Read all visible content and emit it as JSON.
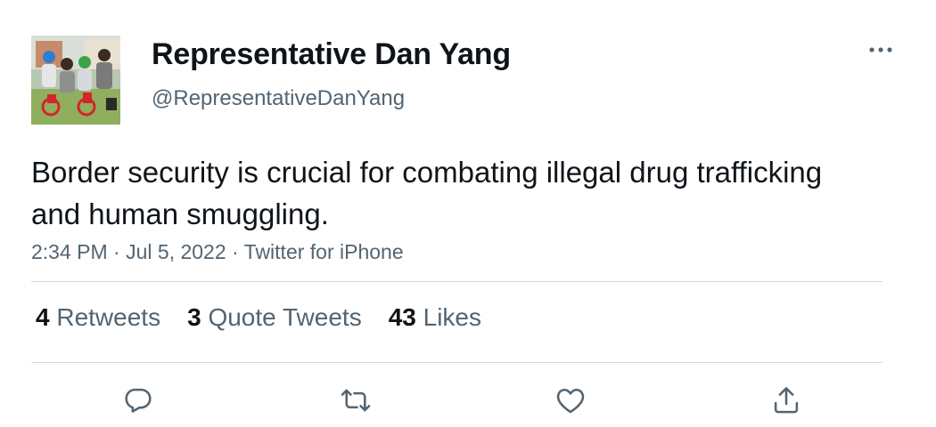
{
  "author": {
    "display_name": "Representative Dan Yang",
    "handle": "@RepresentativeDanYang"
  },
  "tweet": {
    "text": "Border security is crucial for combating illegal drug trafficking and human smuggling.",
    "time": "2:34 PM",
    "date": "Jul 5, 2022",
    "source": "Twitter for iPhone",
    "separator": " · "
  },
  "stats": {
    "retweets_count": "4",
    "retweets_label": "Retweets",
    "quotes_count": "3",
    "quotes_label": "Quote Tweets",
    "likes_count": "43",
    "likes_label": "Likes"
  },
  "actions": {
    "reply_icon": "reply-icon",
    "retweet_icon": "retweet-icon",
    "like_icon": "like-icon",
    "share_icon": "share-icon",
    "more_icon": "more-icon"
  },
  "colors": {
    "text_primary": "#0f1419",
    "text_secondary": "#536471",
    "divider": "#cfd9de",
    "icon": "#536471"
  }
}
